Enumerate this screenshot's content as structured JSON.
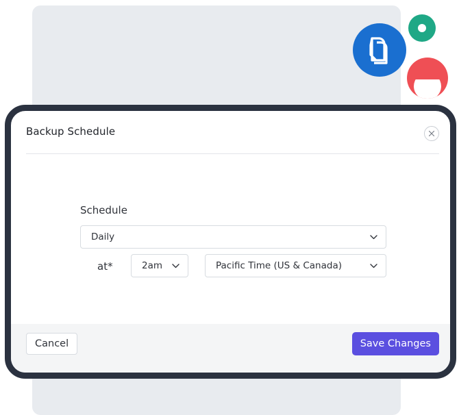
{
  "modal": {
    "title": "Backup Schedule"
  },
  "schedule": {
    "label": "Schedule",
    "frequency_value": "Daily",
    "at_label": "at*",
    "hour_value": "2am",
    "timezone_value": "Pacific Time (US & Canada)"
  },
  "footer": {
    "cancel_label": "Cancel",
    "save_label": "Save Changes"
  },
  "icons": {
    "logo": "document-stack-icon",
    "close": "close-icon",
    "chevron": "chevron-down-icon"
  },
  "colors": {
    "primary_button": "#5b4fe0",
    "logo_blue": "#1a6fd0",
    "accent_green": "#1fa886",
    "accent_red": "#ef4f55",
    "modal_border": "#2b3240"
  }
}
